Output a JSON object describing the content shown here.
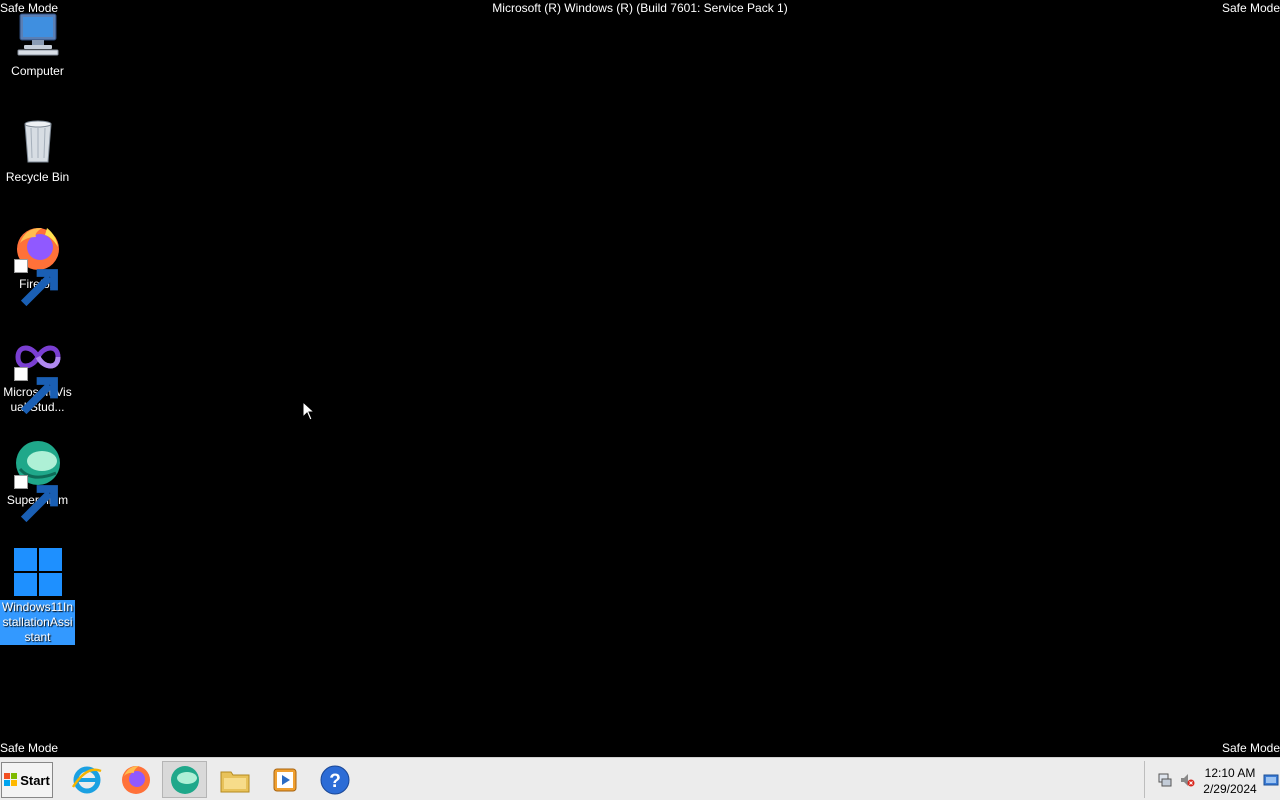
{
  "overlay": {
    "safe_mode_top_left": "Safe Mode",
    "safe_mode_top_right": "Safe Mode",
    "safe_mode_bottom_left": "Safe Mode",
    "safe_mode_bottom_right": "Safe Mode",
    "build_title": "Microsoft (R) Windows (R) (Build 7601: Service Pack 1)"
  },
  "desktop": {
    "background_color": "#000000",
    "selection_color": "#3399ff",
    "icons": [
      {
        "label": "Computer",
        "icon": "computer-icon"
      },
      {
        "label": "Recycle Bin",
        "icon": "recycle-bin-icon"
      },
      {
        "label": "Firefox",
        "icon": "firefox-icon"
      },
      {
        "label": "Microsoft Visual Stud...",
        "icon": "visual-studio-icon"
      },
      {
        "label": "Supermium",
        "icon": "supermium-icon"
      },
      {
        "label": "Windows11InstallationAssistant",
        "icon": "windows-logo-icon",
        "selected": true
      }
    ]
  },
  "taskbar": {
    "start_label": "Start",
    "pinned": [
      {
        "name": "internet-explorer",
        "icon": "internet-explorer-icon"
      },
      {
        "name": "firefox",
        "icon": "firefox-icon"
      },
      {
        "name": "supermium",
        "icon": "supermium-icon",
        "active": true
      },
      {
        "name": "windows-explorer",
        "icon": "folder-icon"
      },
      {
        "name": "media-player",
        "icon": "media-player-icon"
      },
      {
        "name": "help",
        "icon": "help-icon"
      }
    ],
    "tray": {
      "time": "12:10 AM",
      "date": "2/29/2024"
    }
  }
}
